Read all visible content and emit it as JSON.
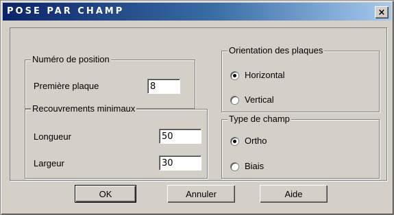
{
  "window": {
    "title": "POSE PAR CHAMP",
    "close_label": "×"
  },
  "numero_position": {
    "title": "Numéro de position",
    "premiere_plaque_label": "Première plaque",
    "premiere_plaque_value": "8"
  },
  "recouvrements": {
    "title": "Recouvrements minimaux",
    "longueur_label": "Longueur",
    "longueur_value": "50",
    "largeur_label": "Largeur",
    "largeur_value": "30"
  },
  "orientation": {
    "title": "Orientation des plaques",
    "options": [
      {
        "label": "Horizontal",
        "checked": true
      },
      {
        "label": "Vertical",
        "checked": false
      }
    ]
  },
  "type_champ": {
    "title": "Type de champ",
    "options": [
      {
        "label": "Ortho",
        "checked": true
      },
      {
        "label": "Biais",
        "checked": false
      }
    ]
  },
  "buttons": {
    "ok": "OK",
    "annuler": "Annuler",
    "aide": "Aide"
  }
}
